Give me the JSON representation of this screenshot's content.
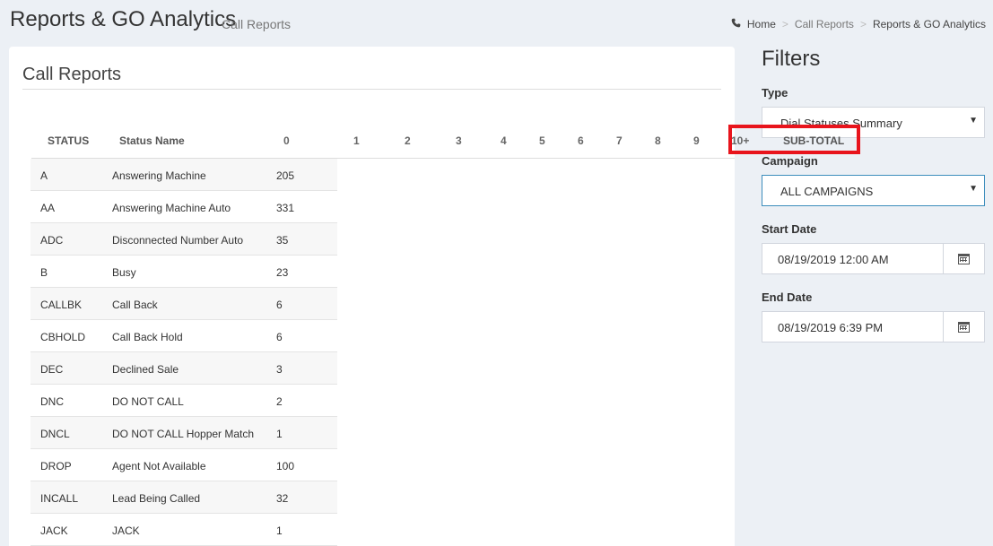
{
  "header": {
    "title": "Reports & GO Analytics",
    "subtitle": "Call Reports"
  },
  "breadcrumb": {
    "icon": "phone-icon",
    "items": [
      "Home",
      "Call Reports",
      "Reports & GO Analytics"
    ],
    "separator": ">"
  },
  "report": {
    "title": "Call Reports",
    "columns": [
      "STATUS",
      "Status Name",
      "0",
      "1",
      "2",
      "3",
      "4",
      "5",
      "6",
      "7",
      "8",
      "9",
      "10+",
      "SUB-TOTAL"
    ],
    "rows": [
      {
        "status": "A",
        "name": "Answering Machine",
        "zero": "205"
      },
      {
        "status": "AA",
        "name": "Answering Machine Auto",
        "zero": "331"
      },
      {
        "status": "ADC",
        "name": "Disconnected Number Auto",
        "zero": "35"
      },
      {
        "status": "B",
        "name": "Busy",
        "zero": "23"
      },
      {
        "status": "CALLBK",
        "name": "Call Back",
        "zero": "6"
      },
      {
        "status": "CBHOLD",
        "name": "Call Back Hold",
        "zero": "6"
      },
      {
        "status": "DEC",
        "name": "Declined Sale",
        "zero": "3"
      },
      {
        "status": "DNC",
        "name": "DO NOT CALL",
        "zero": "2"
      },
      {
        "status": "DNCL",
        "name": "DO NOT CALL Hopper Match",
        "zero": "1"
      },
      {
        "status": "DROP",
        "name": "Agent Not Available",
        "zero": "100"
      },
      {
        "status": "INCALL",
        "name": "Lead Being Called",
        "zero": "32"
      },
      {
        "status": "JACK",
        "name": "JACK",
        "zero": "1"
      }
    ]
  },
  "filters": {
    "title": "Filters",
    "type_label": "Type",
    "type_value": "Dial Statuses Summary",
    "campaign_label": "Campaign",
    "campaign_value": "ALL CAMPAIGNS",
    "start_label": "Start Date",
    "start_value": "08/19/2019 12:00 AM",
    "end_label": "End Date",
    "end_value": "08/19/2019 6:39 PM"
  },
  "colors": {
    "highlight": "#e8141c",
    "accent": "#3c8dbc",
    "background": "#ecf0f5"
  }
}
